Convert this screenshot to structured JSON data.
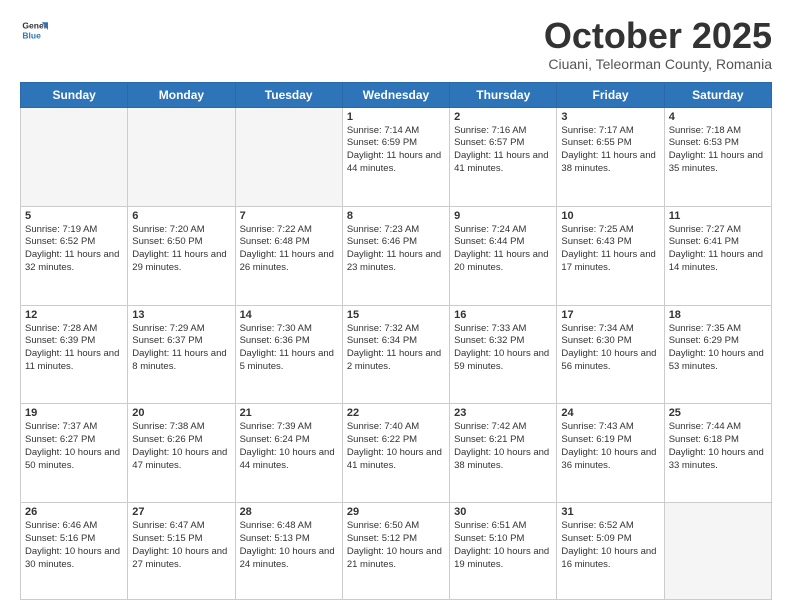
{
  "logo": {
    "general": "General",
    "blue": "Blue"
  },
  "title": "October 2025",
  "location": "Ciuani, Teleorman County, Romania",
  "days_header": [
    "Sunday",
    "Monday",
    "Tuesday",
    "Wednesday",
    "Thursday",
    "Friday",
    "Saturday"
  ],
  "weeks": [
    [
      {
        "num": "",
        "info": ""
      },
      {
        "num": "",
        "info": ""
      },
      {
        "num": "",
        "info": ""
      },
      {
        "num": "1",
        "info": "Sunrise: 7:14 AM\nSunset: 6:59 PM\nDaylight: 11 hours and 44 minutes."
      },
      {
        "num": "2",
        "info": "Sunrise: 7:16 AM\nSunset: 6:57 PM\nDaylight: 11 hours and 41 minutes."
      },
      {
        "num": "3",
        "info": "Sunrise: 7:17 AM\nSunset: 6:55 PM\nDaylight: 11 hours and 38 minutes."
      },
      {
        "num": "4",
        "info": "Sunrise: 7:18 AM\nSunset: 6:53 PM\nDaylight: 11 hours and 35 minutes."
      }
    ],
    [
      {
        "num": "5",
        "info": "Sunrise: 7:19 AM\nSunset: 6:52 PM\nDaylight: 11 hours and 32 minutes."
      },
      {
        "num": "6",
        "info": "Sunrise: 7:20 AM\nSunset: 6:50 PM\nDaylight: 11 hours and 29 minutes."
      },
      {
        "num": "7",
        "info": "Sunrise: 7:22 AM\nSunset: 6:48 PM\nDaylight: 11 hours and 26 minutes."
      },
      {
        "num": "8",
        "info": "Sunrise: 7:23 AM\nSunset: 6:46 PM\nDaylight: 11 hours and 23 minutes."
      },
      {
        "num": "9",
        "info": "Sunrise: 7:24 AM\nSunset: 6:44 PM\nDaylight: 11 hours and 20 minutes."
      },
      {
        "num": "10",
        "info": "Sunrise: 7:25 AM\nSunset: 6:43 PM\nDaylight: 11 hours and 17 minutes."
      },
      {
        "num": "11",
        "info": "Sunrise: 7:27 AM\nSunset: 6:41 PM\nDaylight: 11 hours and 14 minutes."
      }
    ],
    [
      {
        "num": "12",
        "info": "Sunrise: 7:28 AM\nSunset: 6:39 PM\nDaylight: 11 hours and 11 minutes."
      },
      {
        "num": "13",
        "info": "Sunrise: 7:29 AM\nSunset: 6:37 PM\nDaylight: 11 hours and 8 minutes."
      },
      {
        "num": "14",
        "info": "Sunrise: 7:30 AM\nSunset: 6:36 PM\nDaylight: 11 hours and 5 minutes."
      },
      {
        "num": "15",
        "info": "Sunrise: 7:32 AM\nSunset: 6:34 PM\nDaylight: 11 hours and 2 minutes."
      },
      {
        "num": "16",
        "info": "Sunrise: 7:33 AM\nSunset: 6:32 PM\nDaylight: 10 hours and 59 minutes."
      },
      {
        "num": "17",
        "info": "Sunrise: 7:34 AM\nSunset: 6:30 PM\nDaylight: 10 hours and 56 minutes."
      },
      {
        "num": "18",
        "info": "Sunrise: 7:35 AM\nSunset: 6:29 PM\nDaylight: 10 hours and 53 minutes."
      }
    ],
    [
      {
        "num": "19",
        "info": "Sunrise: 7:37 AM\nSunset: 6:27 PM\nDaylight: 10 hours and 50 minutes."
      },
      {
        "num": "20",
        "info": "Sunrise: 7:38 AM\nSunset: 6:26 PM\nDaylight: 10 hours and 47 minutes."
      },
      {
        "num": "21",
        "info": "Sunrise: 7:39 AM\nSunset: 6:24 PM\nDaylight: 10 hours and 44 minutes."
      },
      {
        "num": "22",
        "info": "Sunrise: 7:40 AM\nSunset: 6:22 PM\nDaylight: 10 hours and 41 minutes."
      },
      {
        "num": "23",
        "info": "Sunrise: 7:42 AM\nSunset: 6:21 PM\nDaylight: 10 hours and 38 minutes."
      },
      {
        "num": "24",
        "info": "Sunrise: 7:43 AM\nSunset: 6:19 PM\nDaylight: 10 hours and 36 minutes."
      },
      {
        "num": "25",
        "info": "Sunrise: 7:44 AM\nSunset: 6:18 PM\nDaylight: 10 hours and 33 minutes."
      }
    ],
    [
      {
        "num": "26",
        "info": "Sunrise: 6:46 AM\nSunset: 5:16 PM\nDaylight: 10 hours and 30 minutes."
      },
      {
        "num": "27",
        "info": "Sunrise: 6:47 AM\nSunset: 5:15 PM\nDaylight: 10 hours and 27 minutes."
      },
      {
        "num": "28",
        "info": "Sunrise: 6:48 AM\nSunset: 5:13 PM\nDaylight: 10 hours and 24 minutes."
      },
      {
        "num": "29",
        "info": "Sunrise: 6:50 AM\nSunset: 5:12 PM\nDaylight: 10 hours and 21 minutes."
      },
      {
        "num": "30",
        "info": "Sunrise: 6:51 AM\nSunset: 5:10 PM\nDaylight: 10 hours and 19 minutes."
      },
      {
        "num": "31",
        "info": "Sunrise: 6:52 AM\nSunset: 5:09 PM\nDaylight: 10 hours and 16 minutes."
      },
      {
        "num": "",
        "info": ""
      }
    ]
  ]
}
